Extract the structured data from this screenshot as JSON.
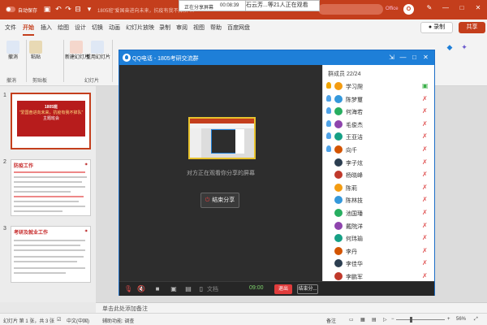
{
  "titlebar": {
    "autosave_label": "自动保存",
    "doc_title": "1805班\"爱国奋进向未来，抗疫有我不掉队\"…",
    "sharing_status": "正在分享屏幕",
    "sharing_time": "00:08:39",
    "watching": "石云芳...等21人正在观看",
    "office_label": "Office",
    "avatar_letter": "O"
  },
  "menu": {
    "items": [
      "文件",
      "开始",
      "插入",
      "绘图",
      "设计",
      "切换",
      "动画",
      "幻灯片放映",
      "录制",
      "审阅",
      "视图",
      "帮助",
      "百度网盘"
    ],
    "active": "开始",
    "record_label": "● 录制",
    "share_label": "共享"
  },
  "ribbon": {
    "buttons": [
      "撤消",
      "粘贴",
      "新建幻灯片",
      "重用幻灯片"
    ],
    "groups": [
      "撤消",
      "剪贴板",
      "幻灯片"
    ]
  },
  "slides": [
    {
      "num": "1",
      "title": "1805班",
      "subtitle": "\"爱国奋进向未来，抗疫有我不掉队\"",
      "caption": "主题班会"
    },
    {
      "num": "2",
      "title": "防疫工作"
    },
    {
      "num": "3",
      "title": "考研及就业工作"
    }
  ],
  "qq": {
    "title": "QQ电话 - 1805考研交流群",
    "share_text": "对方正在观看你分享的屏幕",
    "end_share_label": "结束分享",
    "members_header": "群成员 22/24",
    "members": [
      {
        "name": "学习爬",
        "mic": "on",
        "role": "owner"
      },
      {
        "name": "陈梦璽",
        "mic": "muted",
        "role": "admin"
      },
      {
        "name": "何海若",
        "mic": "muted",
        "role": "admin"
      },
      {
        "name": "毛俊杰",
        "mic": "muted",
        "role": "admin"
      },
      {
        "name": "王亚洁",
        "mic": "muted",
        "role": "admin"
      },
      {
        "name": "向千",
        "mic": "muted",
        "role": "admin"
      },
      {
        "name": "李子炫",
        "mic": "muted",
        "role": "member"
      },
      {
        "name": "杨晓峰",
        "mic": "muted",
        "role": "member"
      },
      {
        "name": "陈莉",
        "mic": "muted",
        "role": "member"
      },
      {
        "name": "陈林技",
        "mic": "muted",
        "role": "member"
      },
      {
        "name": "池国璠",
        "mic": "muted",
        "role": "member"
      },
      {
        "name": "戴院洋",
        "mic": "muted",
        "role": "member"
      },
      {
        "name": "何玮瑜",
        "mic": "muted",
        "role": "member"
      },
      {
        "name": "李丹",
        "mic": "muted",
        "role": "member"
      },
      {
        "name": "李佳华",
        "mic": "muted",
        "role": "member"
      },
      {
        "name": "李鹏军",
        "mic": "muted",
        "role": "member"
      }
    ],
    "bottom": {
      "doc_label": "文档",
      "timer": "09:00",
      "exit_label": "退出",
      "end_label": "结束分..."
    }
  },
  "notes_placeholder": "单击此处添加备注",
  "status": {
    "slide_info": "幻灯片 第 1 张，共 3 张",
    "language": "中文(中国)",
    "accessibility": "辅助功能: 调查",
    "notes_btn": "备注",
    "zoom": "56%",
    "zoom_fraction": 0.56
  },
  "colors": {
    "brand": "#c43e1c",
    "qq_blue": "#1e7fd8",
    "mic_muted": "#e05555",
    "mic_on": "#3bb04a"
  }
}
